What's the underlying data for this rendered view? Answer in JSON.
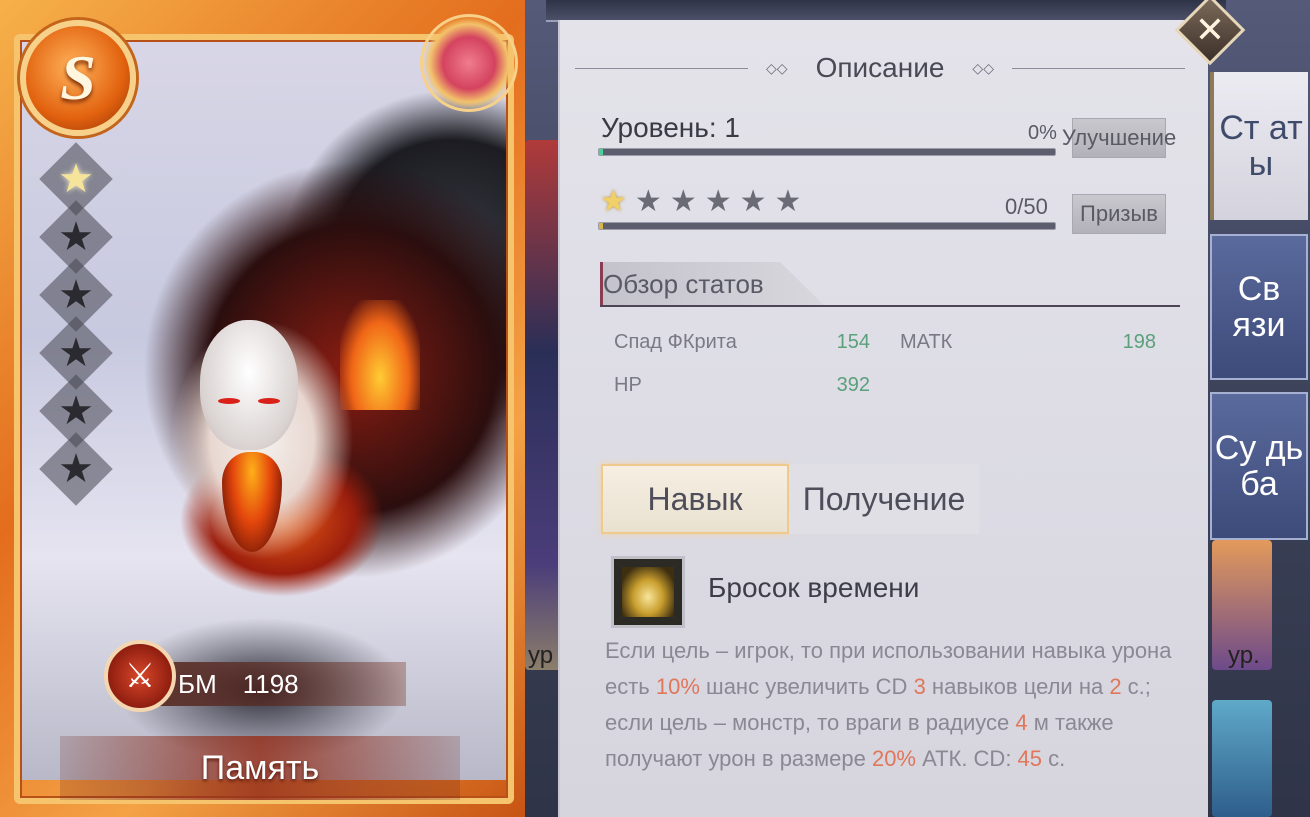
{
  "hero": {
    "rank": "S",
    "stars_total": 6,
    "stars_filled": 1,
    "bm_label": "БМ",
    "bm_value": "1198",
    "memory_button": "Память"
  },
  "panel": {
    "title": "Описание",
    "level_label": "Уровень: 1",
    "level_percent": "0%",
    "level_progress": 0.0,
    "upgrade_button": "Улучшение",
    "stars": {
      "filled": 1,
      "total": 6
    },
    "star_progress_text": "0/50",
    "star_progress": 0.0,
    "summon_button": "Призыв",
    "stats_header": "Обзор статов",
    "stats": [
      {
        "name": "Спад ФКрита",
        "value": "154"
      },
      {
        "name": "МАТК",
        "value": "198"
      },
      {
        "name": "HP",
        "value": "392"
      }
    ],
    "sub_tabs": [
      {
        "label": "Навык",
        "active": true
      },
      {
        "label": "Получение",
        "active": false
      }
    ],
    "skill": {
      "name": "Бросок времени",
      "desc": {
        "p1": "Если цель – игрок, то при использовании навыка урона есть ",
        "v1": "10%",
        "p2": " шанс увеличить CD ",
        "v2": "3",
        "p3": " навыков цели на ",
        "v3": "2",
        "p4": " с.; если цель – монстр, то враги в радиусе ",
        "v4": "4",
        "p5": " м также получают урон в размере ",
        "v5": "20%",
        "p6": " АТК. CD: ",
        "v6": "45",
        "p7": " с."
      }
    }
  },
  "side_tabs": [
    {
      "label": "Ст ат ы",
      "active": true
    },
    {
      "label": "Св язи",
      "active": false
    },
    {
      "label": "Су дь ба",
      "active": false
    }
  ],
  "background": {
    "left_card_label": "ур",
    "right_card_label": "ур."
  },
  "colors": {
    "highlight": "#e0765a",
    "stat_value": "#5aa07a",
    "panel_bg": "#e4e3ea"
  },
  "icons": {
    "close": "close-icon",
    "bm": "crossed-swords-icon",
    "star": "star-icon"
  }
}
